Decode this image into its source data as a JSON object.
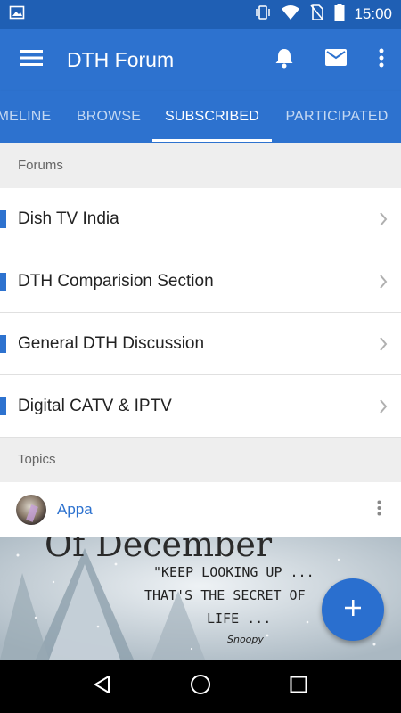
{
  "status_bar": {
    "time": "15:00",
    "icons": [
      "image-icon",
      "vibrate-icon",
      "wifi-icon",
      "no-sim-icon",
      "battery-icon"
    ],
    "color": "#1f5fb4"
  },
  "app_bar": {
    "title": "DTH Forum",
    "color": "#2d72cf",
    "actions": [
      "bell-icon",
      "mail-icon",
      "more-vert-icon"
    ]
  },
  "tabs": [
    {
      "label": "MELINE",
      "active": false
    },
    {
      "label": "BROWSE",
      "active": false
    },
    {
      "label": "SUBSCRIBED",
      "active": true
    },
    {
      "label": "PARTICIPATED",
      "active": false
    }
  ],
  "sections": {
    "forums_header": "Forums",
    "topics_header": "Topics"
  },
  "forums": [
    {
      "label": "Dish TV India"
    },
    {
      "label": "DTH Comparision Section"
    },
    {
      "label": "General DTH Discussion"
    },
    {
      "label": "Digital CATV & IPTV"
    }
  ],
  "topic": {
    "author": "Appa",
    "image_text": {
      "heading": "Of December",
      "line1": "\"KEEP LOOKING UP ...",
      "line2": "THAT'S THE SECRET OF",
      "line3": "LIFE ...",
      "signature": "Snoopy"
    }
  },
  "fab": {
    "icon": "add-icon",
    "color": "#2a6fcf"
  },
  "nav_bar": {
    "buttons": [
      "back-icon",
      "home-icon",
      "recents-icon"
    ]
  }
}
